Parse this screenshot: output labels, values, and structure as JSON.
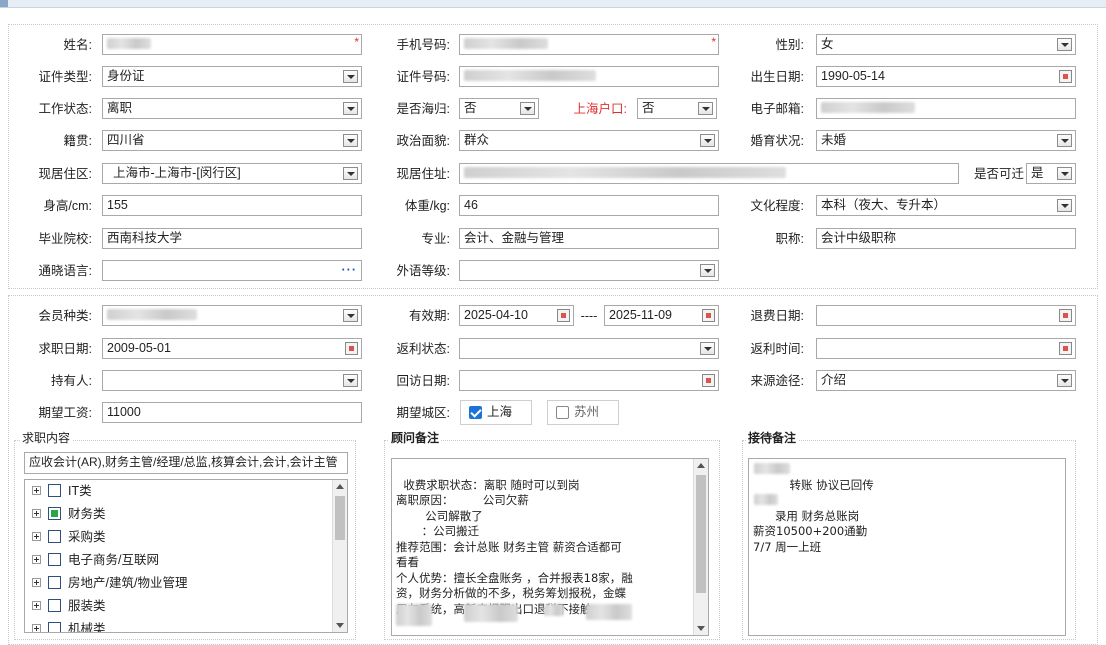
{
  "personal": {
    "name_label": "姓名:",
    "phone_label": "手机号码:",
    "gender_label": "性别:",
    "gender_value": "女",
    "id_type_label": "证件类型:",
    "id_type_value": "身份证",
    "id_no_label": "证件号码:",
    "birth_label": "出生日期:",
    "birth_value": "1990-05-14",
    "work_status_label": "工作状态:",
    "work_status_value": "离职",
    "overseas_label": "是否海归:",
    "overseas_value": "否",
    "shanghai_hukou_label": "上海户口:",
    "shanghai_hukou_value": "否",
    "email_label": "电子邮箱:",
    "native_label": "籍贯:",
    "native_value": "四川省",
    "political_label": "政治面貌:",
    "political_value": "群众",
    "marital_label": "婚育状况:",
    "marital_value": "未婚",
    "residence_area_label": "现居住区:",
    "residence_area_value": "上海市-上海市-[闵行区]",
    "address_label": "现居住址:",
    "relocate_label": "是否可迁",
    "relocate_value": "是",
    "height_label": "身高/cm:",
    "height_value": "155",
    "weight_label": "体重/kg:",
    "weight_value": "46",
    "education_label": "文化程度:",
    "education_value": "本科（夜大、专升本）",
    "school_label": "毕业院校:",
    "school_value": "西南科技大学",
    "major_label": "专业:",
    "major_value": "会计、金融与管理",
    "title_label": "职称:",
    "title_value": "会计中级职称",
    "language_label": "通晓语言:",
    "language_value": "",
    "foreign_level_label": "外语等级:",
    "foreign_level_value": ""
  },
  "membership": {
    "member_type_label": "会员种类:",
    "valid_label": "有效期:",
    "valid_from": "2025-04-10",
    "valid_sep": "----",
    "valid_to": "2025-11-09",
    "refund_date_label": "退费日期:",
    "refund_date_value": "",
    "job_date_label": "求职日期:",
    "job_date_value": "2009-05-01",
    "rebate_status_label": "返利状态:",
    "rebate_status_value": "",
    "rebate_time_label": "返利时间:",
    "rebate_time_value": "",
    "holder_label": "持有人:",
    "holder_value": "",
    "visit_date_label": "回访日期:",
    "visit_date_value": "",
    "source_label": "来源途径:",
    "source_value": "介绍",
    "salary_label": "期望工资:",
    "salary_value": "11000",
    "city_label": "期望城区:",
    "city_options": [
      {
        "label": "上海",
        "checked": true
      },
      {
        "label": "苏州",
        "checked": false
      }
    ]
  },
  "job_content": {
    "header": "求职内容",
    "summary": "应收会计(AR),财务主管/经理/总监,核算会计,会计,会计主管",
    "tree": [
      {
        "label": "IT类",
        "state": "none"
      },
      {
        "label": "财务类",
        "state": "partial"
      },
      {
        "label": "采购类",
        "state": "none"
      },
      {
        "label": "电子商务/互联网",
        "state": "none"
      },
      {
        "label": "房地产/建筑/物业管理",
        "state": "none"
      },
      {
        "label": "服装类",
        "state": "none"
      },
      {
        "label": "机械类",
        "state": "none"
      }
    ]
  },
  "consultant_notes": {
    "header": "顾问备注",
    "text": "收费求职状态：离职 随时可以到岗\n离职原因：        公司欠薪\n        公司解散了\n       ：公司搬迁\n推荐范围：会计总账 财务主管 薪资合适都可\n看看\n个人优势：擅长全盘账务 ，合并报表18家，融\n资，财务分析做的不多，税务筹划报税，金蝶\n用友系统，高新申报跟出口退税不接触"
  },
  "reception_notes": {
    "header": "接待备注",
    "text": "        转账 协议已回传\n\n      录用 财务总账岗\n薪资10500+200通勤\n7/7 周一上班"
  },
  "colors": {
    "required": "#e03030",
    "accent": "#1e73d8",
    "tree_partial": "#28a745"
  }
}
